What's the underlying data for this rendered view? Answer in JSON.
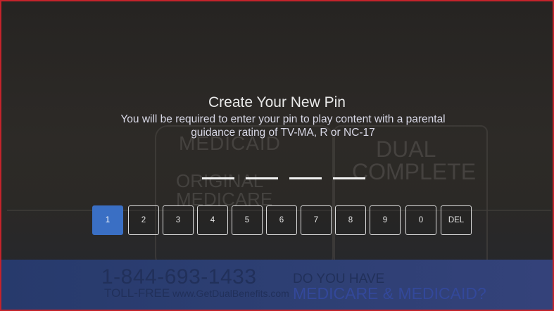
{
  "dialog": {
    "title": "Create Your New Pin",
    "subtitle": "You will be required to enter your pin to play content with a parental guidance rating of TV-MA, R or NC-17"
  },
  "pin": {
    "length": 4,
    "entered": 0
  },
  "keypad": {
    "selected": "1",
    "keys": [
      "1",
      "2",
      "3",
      "4",
      "5",
      "6",
      "7",
      "8",
      "9",
      "0",
      "DEL"
    ]
  },
  "background_ad": {
    "medicaid": "MEDICAID",
    "original": "ORIGINAL",
    "medicare": "MEDICARE",
    "dual": "DUAL",
    "complete": "COMPLETE",
    "phone": "1-844-693-1433",
    "tollfree_label": "TOLL-FREE",
    "website": "www.GetDualBenefits.com",
    "question_line1": "DO YOU HAVE",
    "question_line2": "MEDICARE & MEDICAID?"
  },
  "colors": {
    "frame_border": "#c4232b",
    "selected_key": "#3a6fc4"
  }
}
